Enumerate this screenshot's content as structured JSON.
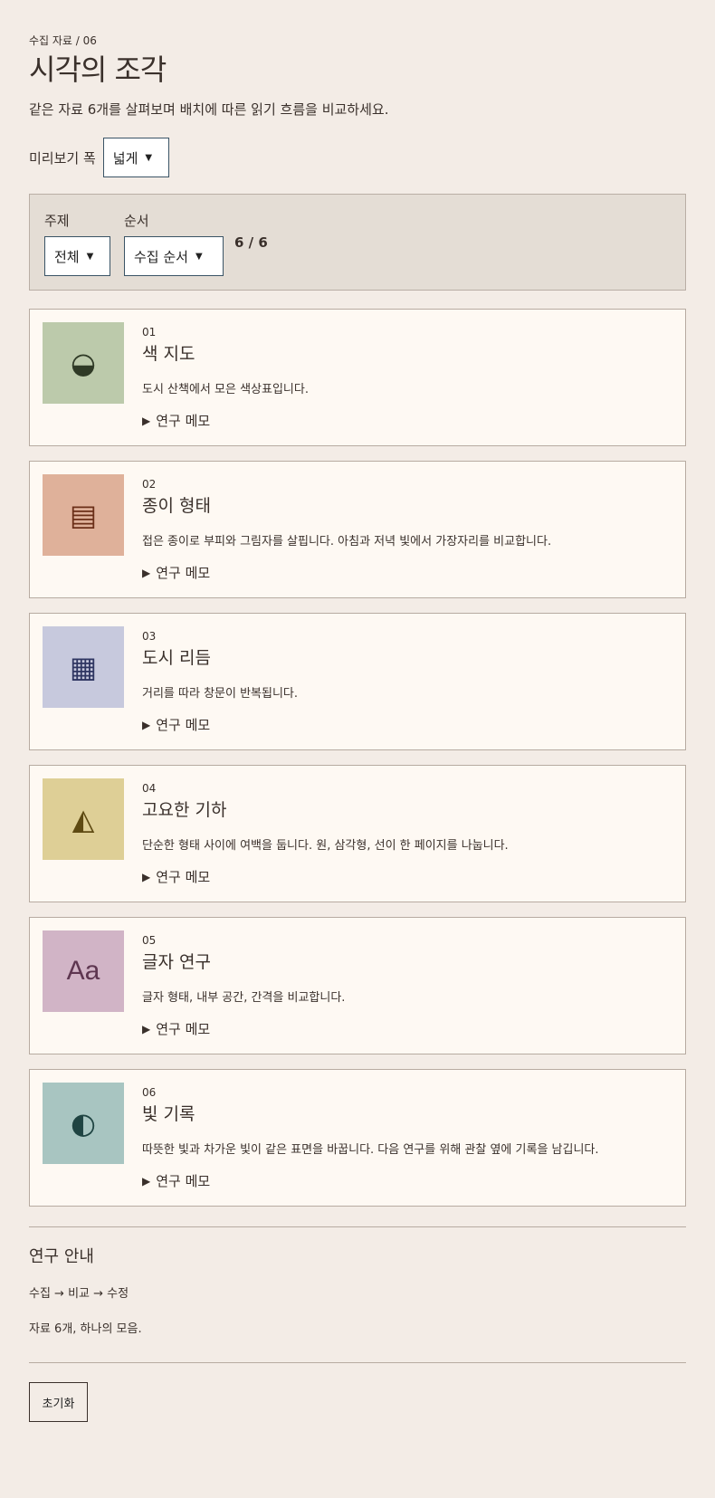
{
  "header": {
    "crumb": "수집 자료 / 06",
    "title": "시각의 조각",
    "intro": "같은 자료 6개를 살펴보며 배치에 따른 읽기 흐름을 비교하세요."
  },
  "preview": {
    "label": "미리보기 폭",
    "value": "넓게"
  },
  "filters": {
    "topic_label": "주제",
    "topic_value": "전체",
    "order_label": "순서",
    "order_value": "수집 순서",
    "count": "6 / 6"
  },
  "items": [
    {
      "num": "01",
      "title": "색 지도",
      "desc": "도시 산책에서 모은 색상표입니다.",
      "memo": "연구 메모",
      "glyph": "◒",
      "icon": "half-circle-icon",
      "bg": "#bccaab",
      "fg": "#2f3a26"
    },
    {
      "num": "02",
      "title": "종이 형태",
      "desc": "접은 종이로 부피와 그림자를 살핍니다. 아침과 저녁 빛에서 가장자리를 비교합니다.",
      "memo": "연구 메모",
      "glyph": "▤",
      "icon": "lined-square-icon",
      "bg": "#dfb19a",
      "fg": "#6b2f18"
    },
    {
      "num": "03",
      "title": "도시 리듬",
      "desc": "거리를 따라 창문이 반복됩니다.",
      "memo": "연구 메모",
      "glyph": "▦",
      "icon": "grid-square-icon",
      "bg": "#c7c9dd",
      "fg": "#2e3561"
    },
    {
      "num": "04",
      "title": "고요한 기하",
      "desc": "단순한 형태 사이에 여백을 둡니다. 원, 삼각형, 선이 한 페이지를 나눕니다.",
      "memo": "연구 메모",
      "glyph": "◭",
      "icon": "triangle-icon",
      "bg": "#decf96",
      "fg": "#5e4a12"
    },
    {
      "num": "05",
      "title": "글자 연구",
      "desc": "글자 형태, 내부 공간, 간격을 비교합니다.",
      "memo": "연구 메모",
      "glyph": "Aa",
      "icon": "type-specimen-icon",
      "bg": "#d1b4c6",
      "fg": "#5e3650"
    },
    {
      "num": "06",
      "title": "빛 기록",
      "desc": "따뜻한 빛과 차가운 빛이 같은 표면을 바꿉니다. 다음 연구를 위해 관찰 옆에 기록을 남깁니다.",
      "memo": "연구 메모",
      "glyph": "◐",
      "icon": "half-moon-icon",
      "bg": "#a8c5c1",
      "fg": "#1f4442"
    }
  ],
  "guide": {
    "title": "연구 안내",
    "flow": "수집 → 비교 → 수정",
    "summary": "자료 6개, 하나의 모음."
  },
  "footer": {
    "reset": "초기화"
  }
}
